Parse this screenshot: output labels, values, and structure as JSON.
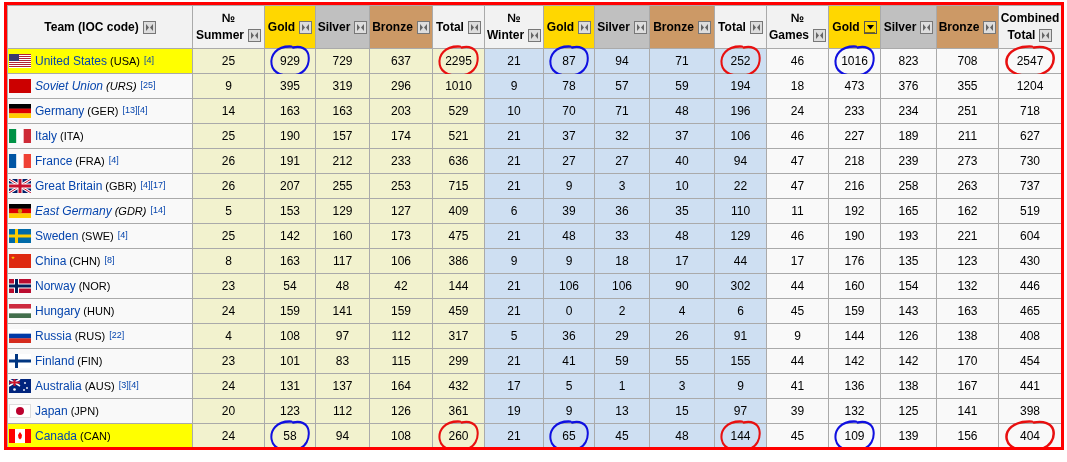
{
  "headers": [
    {
      "lines": [
        "Team (IOC code)"
      ],
      "color": "#f2f2f2",
      "kind": "team",
      "sorted": false
    },
    {
      "lines": [
        "№",
        "Summer"
      ],
      "color": "#f2f2f2",
      "kind": "summer",
      "sorted": false
    },
    {
      "lines": [
        "Gold"
      ],
      "color": "#ffd700",
      "kind": "summer",
      "sorted": false
    },
    {
      "lines": [
        "Silver"
      ],
      "color": "#c0c0c0",
      "kind": "summer",
      "sorted": false
    },
    {
      "lines": [
        "Bronze"
      ],
      "color": "#cc9966",
      "kind": "summer",
      "sorted": false
    },
    {
      "lines": [
        "Total"
      ],
      "color": "#f2f2f2",
      "kind": "summer",
      "sorted": false
    },
    {
      "lines": [
        "№",
        "Winter"
      ],
      "color": "#f2f2f2",
      "kind": "winter",
      "sorted": false
    },
    {
      "lines": [
        "Gold"
      ],
      "color": "#ffd700",
      "kind": "winter",
      "sorted": false
    },
    {
      "lines": [
        "Silver"
      ],
      "color": "#c0c0c0",
      "kind": "winter",
      "sorted": false
    },
    {
      "lines": [
        "Bronze"
      ],
      "color": "#cc9966",
      "kind": "winter",
      "sorted": false
    },
    {
      "lines": [
        "Total"
      ],
      "color": "#f2f2f2",
      "kind": "winter",
      "sorted": false
    },
    {
      "lines": [
        "№",
        "Games"
      ],
      "color": "#f2f2f2",
      "kind": "combined",
      "sorted": false
    },
    {
      "lines": [
        "Gold"
      ],
      "color": "#ffd700",
      "kind": "combined",
      "sorted": true
    },
    {
      "lines": [
        "Silver"
      ],
      "color": "#c0c0c0",
      "kind": "combined",
      "sorted": false
    },
    {
      "lines": [
        "Bronze"
      ],
      "color": "#cc9966",
      "kind": "combined",
      "sorted": false
    },
    {
      "lines": [
        "Combined",
        "Total"
      ],
      "color": "#f2f2f2",
      "kind": "combined",
      "sorted": false
    }
  ],
  "rows": [
    {
      "name": "United States",
      "code": "(USA)",
      "refs": "[4]",
      "italic": false,
      "highlighted": true,
      "values": [
        "25",
        {
          "text": "929",
          "color": "#1010e0"
        },
        "729",
        "637",
        {
          "text": "2295",
          "color": "#e81010"
        },
        "21",
        {
          "text": "87",
          "color": "#1010e0"
        },
        "94",
        "71",
        {
          "text": "252",
          "color": "#e81010"
        },
        "46",
        {
          "text": "1016",
          "color": "#1010e0"
        },
        "823",
        "708",
        {
          "text": "2547",
          "color": "#e81010"
        }
      ]
    },
    {
      "name": "Soviet Union",
      "code": "(URS)",
      "refs": "[25]",
      "italic": true,
      "highlighted": false,
      "values": [
        "9",
        "395",
        "319",
        "296",
        "1010",
        "9",
        "78",
        "57",
        "59",
        "194",
        "18",
        "473",
        "376",
        "355",
        "1204"
      ]
    },
    {
      "name": "Germany",
      "code": "(GER)",
      "refs": "[13][4]",
      "italic": false,
      "highlighted": false,
      "values": [
        "14",
        "163",
        "163",
        "203",
        "529",
        "10",
        "70",
        "71",
        "48",
        "196",
        "24",
        "233",
        "234",
        "251",
        "718"
      ]
    },
    {
      "name": "Italy",
      "code": "(ITA)",
      "refs": "",
      "italic": false,
      "highlighted": false,
      "values": [
        "25",
        "190",
        "157",
        "174",
        "521",
        "21",
        "37",
        "32",
        "37",
        "106",
        "46",
        "227",
        "189",
        "211",
        "627"
      ]
    },
    {
      "name": "France",
      "code": "(FRA)",
      "refs": "[4]",
      "italic": false,
      "highlighted": false,
      "values": [
        "26",
        "191",
        "212",
        "233",
        "636",
        "21",
        "27",
        "27",
        "40",
        "94",
        "47",
        "218",
        "239",
        "273",
        "730"
      ]
    },
    {
      "name": "Great Britain",
      "code": "(GBR)",
      "refs": "[4][17]",
      "italic": false,
      "highlighted": false,
      "values": [
        "26",
        "207",
        "255",
        "253",
        "715",
        "21",
        "9",
        "3",
        "10",
        "22",
        "47",
        "216",
        "258",
        "263",
        "737"
      ]
    },
    {
      "name": "East Germany",
      "code": "(GDR)",
      "refs": "[14]",
      "italic": true,
      "highlighted": false,
      "values": [
        "5",
        "153",
        "129",
        "127",
        "409",
        "6",
        "39",
        "36",
        "35",
        "110",
        "11",
        "192",
        "165",
        "162",
        "519"
      ]
    },
    {
      "name": "Sweden",
      "code": "(SWE)",
      "refs": "[4]",
      "italic": false,
      "highlighted": false,
      "values": [
        "25",
        "142",
        "160",
        "173",
        "475",
        "21",
        "48",
        "33",
        "48",
        "129",
        "46",
        "190",
        "193",
        "221",
        "604"
      ]
    },
    {
      "name": "China",
      "code": "(CHN)",
      "refs": "[8]",
      "italic": false,
      "highlighted": false,
      "values": [
        "8",
        "163",
        "117",
        "106",
        "386",
        "9",
        "9",
        "18",
        "17",
        "44",
        "17",
        "176",
        "135",
        "123",
        "430"
      ]
    },
    {
      "name": "Norway",
      "code": "(NOR)",
      "refs": "",
      "italic": false,
      "highlighted": false,
      "values": [
        "23",
        "54",
        "48",
        "42",
        "144",
        "21",
        "106",
        "106",
        "90",
        "302",
        "44",
        "160",
        "154",
        "132",
        "446"
      ]
    },
    {
      "name": "Hungary",
      "code": "(HUN)",
      "refs": "",
      "italic": false,
      "highlighted": false,
      "values": [
        "24",
        "159",
        "141",
        "159",
        "459",
        "21",
        "0",
        "2",
        "4",
        "6",
        "45",
        "159",
        "143",
        "163",
        "465"
      ]
    },
    {
      "name": "Russia",
      "code": "(RUS)",
      "refs": "[22]",
      "italic": false,
      "highlighted": false,
      "values": [
        "4",
        "108",
        "97",
        "112",
        "317",
        "5",
        "36",
        "29",
        "26",
        "91",
        "9",
        "144",
        "126",
        "138",
        "408"
      ]
    },
    {
      "name": "Finland",
      "code": "(FIN)",
      "refs": "",
      "italic": false,
      "highlighted": false,
      "values": [
        "23",
        "101",
        "83",
        "115",
        "299",
        "21",
        "41",
        "59",
        "55",
        "155",
        "44",
        "142",
        "142",
        "170",
        "454"
      ]
    },
    {
      "name": "Australia",
      "code": "(AUS)",
      "refs": "[3][4]",
      "italic": false,
      "highlighted": false,
      "values": [
        "24",
        "131",
        "137",
        "164",
        "432",
        "17",
        "5",
        "1",
        "3",
        "9",
        "41",
        "136",
        "138",
        "167",
        "441"
      ]
    },
    {
      "name": "Japan",
      "code": "(JPN)",
      "refs": "",
      "italic": false,
      "highlighted": false,
      "values": [
        "20",
        "123",
        "112",
        "126",
        "361",
        "19",
        "9",
        "13",
        "15",
        "97",
        "39",
        "132",
        "125",
        "141",
        "398"
      ]
    },
    {
      "name": "Canada",
      "code": "(CAN)",
      "refs": "",
      "italic": false,
      "highlighted": true,
      "values": [
        "24",
        {
          "text": "58",
          "color": "#1010e0"
        },
        "94",
        "108",
        {
          "text": "260",
          "color": "#e81010"
        },
        "21",
        {
          "text": "65",
          "color": "#1010e0"
        },
        "45",
        "48",
        {
          "text": "144",
          "color": "#e81010"
        },
        "45",
        {
          "text": "109",
          "color": "#1010e0"
        },
        "139",
        "156",
        {
          "text": "404",
          "color": "#e81010"
        }
      ]
    }
  ]
}
